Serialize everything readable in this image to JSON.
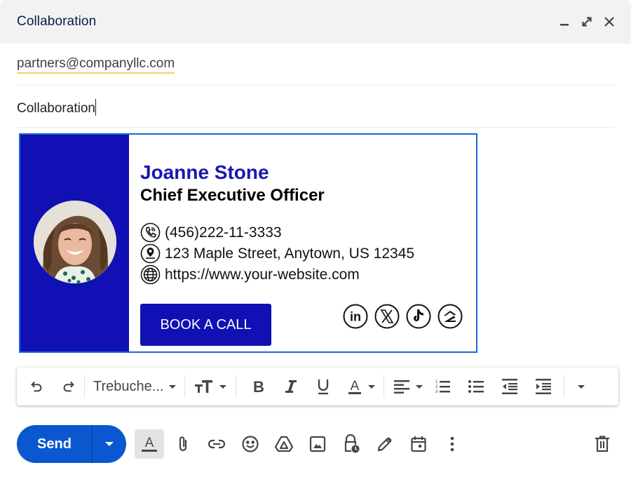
{
  "window": {
    "title": "Collaboration",
    "controls": [
      "minimize",
      "full-screen",
      "close"
    ]
  },
  "compose": {
    "to": "partners@companyllc.com",
    "subject": "Collaboration"
  },
  "signature": {
    "name": "Joanne Stone",
    "role": "Chief Executive Officer",
    "phone": "(456)222-11-3333",
    "address": "123 Maple Street, Anytown, US 12345",
    "website": "https://www.your-website.com",
    "cta_label": "BOOK A CALL",
    "socials": [
      "linkedin",
      "x",
      "tiktok",
      "zillow"
    ],
    "colors": {
      "primary": "#1010b4",
      "name": "#1717b2",
      "border": "#1a6ad2"
    }
  },
  "format_toolbar": {
    "font": "Trebuche...",
    "items": [
      "undo",
      "redo",
      "font",
      "text-size",
      "bold",
      "italic",
      "underline",
      "text-color",
      "align",
      "numbered-list",
      "bulleted-list",
      "indent-less",
      "indent-more",
      "more-formatting"
    ]
  },
  "bottom_bar": {
    "send_label": "Send",
    "send_color": "#0b57d0",
    "icons": [
      "formatting-options",
      "attach-files",
      "insert-link",
      "insert-emoji",
      "insert-drive",
      "insert-photo",
      "confidential-mode",
      "insert-signature",
      "schedule",
      "more-options",
      "discard-draft"
    ]
  }
}
